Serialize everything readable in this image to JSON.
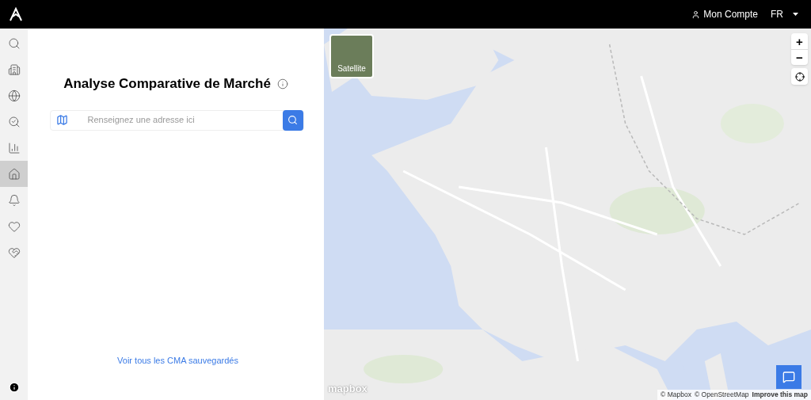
{
  "header": {
    "account": "Mon Compte",
    "language": "FR"
  },
  "sidebar": {
    "items": [
      {
        "kind": "search",
        "selected": false
      },
      {
        "kind": "building",
        "selected": false
      },
      {
        "kind": "globe",
        "selected": false
      },
      {
        "kind": "analysis",
        "selected": false
      },
      {
        "kind": "chart",
        "selected": false
      },
      {
        "kind": "home",
        "selected": true
      },
      {
        "kind": "bell",
        "selected": false
      },
      {
        "kind": "heart",
        "selected": false
      },
      {
        "kind": "handshake",
        "selected": false
      }
    ]
  },
  "panel": {
    "title": "Analyse Comparative de Marché",
    "search": {
      "placeholder": "Renseignez une adresse ici"
    },
    "saved_link": "Voir tous les CMA sauvegardés"
  },
  "map": {
    "style_toggle": "Satellite",
    "zoom_in": "+",
    "zoom_out": "−",
    "logo": "mapbox",
    "attribution": [
      "© Mapbox",
      "© OpenStreetMap"
    ],
    "improve_link": "Improve this map"
  }
}
